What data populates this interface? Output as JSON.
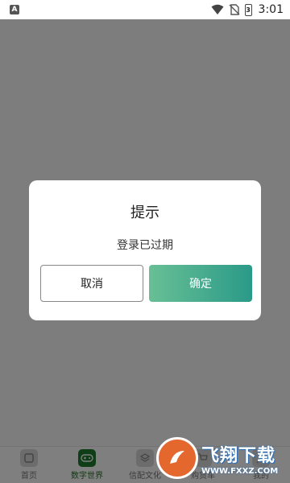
{
  "status_bar": {
    "notification_letter": "A",
    "time": "3:01",
    "battery_level": "3",
    "icons": [
      "wifi-icon",
      "no-sim-icon",
      "battery-icon"
    ]
  },
  "bottom_nav": {
    "items": [
      {
        "label": "首页",
        "icon": "home-icon",
        "active": false
      },
      {
        "label": "数字世界",
        "icon": "gamepad-icon",
        "active": true
      },
      {
        "label": "信配文化",
        "icon": "layers-icon",
        "active": false
      },
      {
        "label": "购货车",
        "icon": "cart-icon",
        "active": false
      },
      {
        "label": "我的",
        "icon": "user-icon",
        "active": false
      }
    ]
  },
  "dialog": {
    "title": "提示",
    "message": "登录已过期",
    "cancel_label": "取消",
    "confirm_label": "确定"
  },
  "watermark": {
    "title": "飞翔下载",
    "subtitle": "WWW.FXXZ.COM"
  },
  "colors": {
    "confirm_gradient_start": "#68bf95",
    "confirm_gradient_end": "#2a9a88",
    "active_nav": "#1f7a2e",
    "overlay": "rgba(0,0,0,0.5)"
  }
}
